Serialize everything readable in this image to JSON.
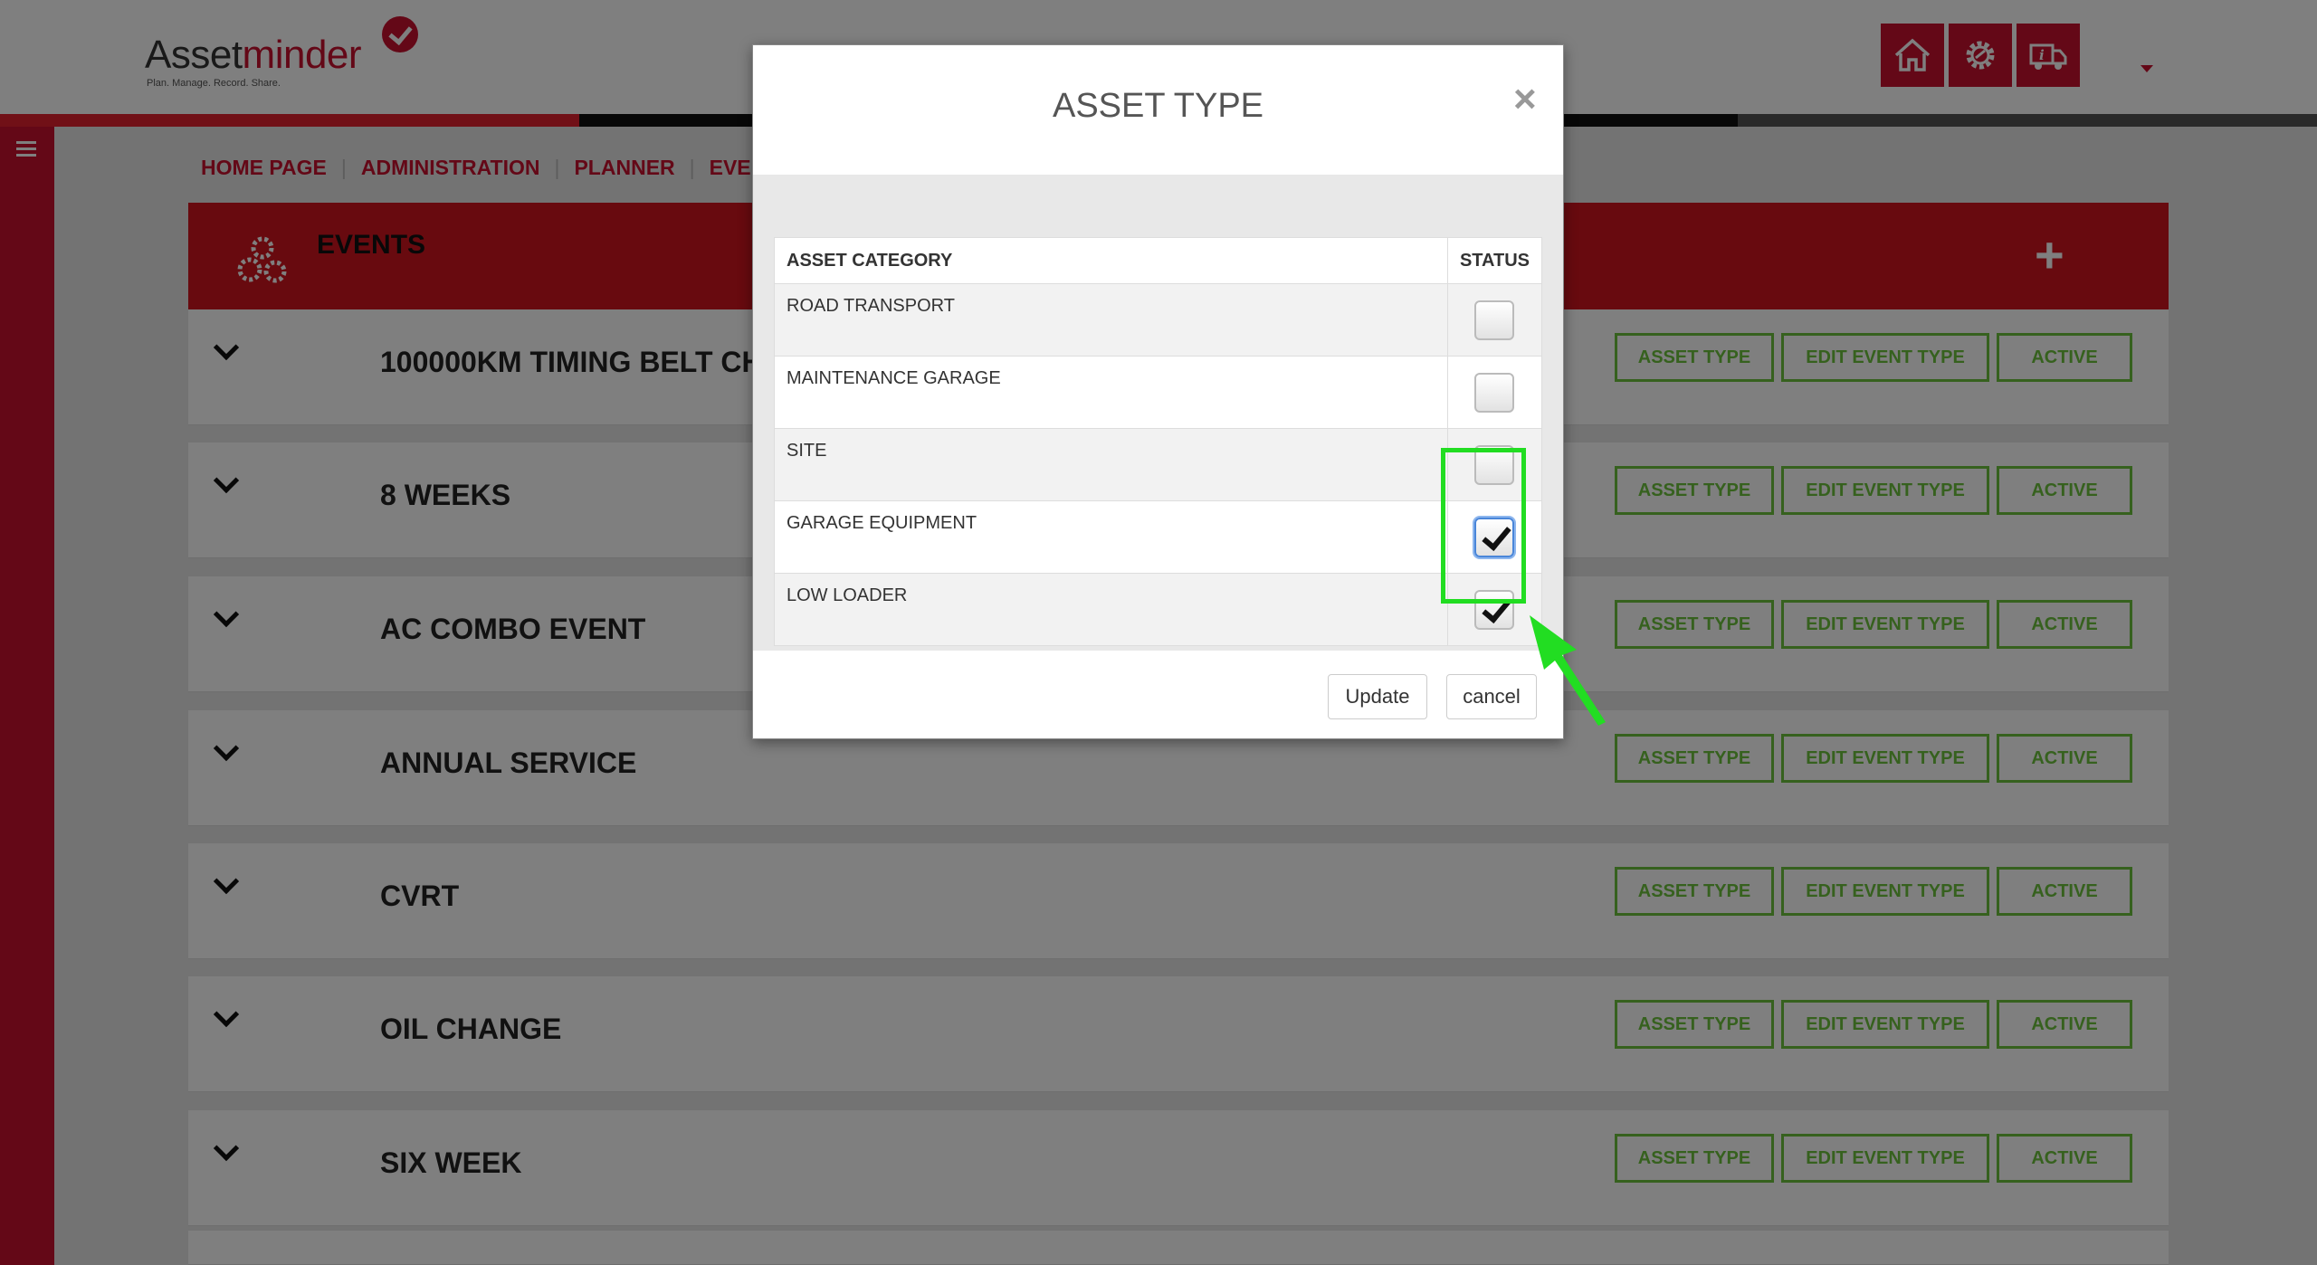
{
  "app": {
    "logo_main": "Asset",
    "logo_accent": "minder",
    "logo_tagline": "Plan. Manage. Record. Share."
  },
  "top_icons": [
    "home-icon",
    "settings-icon",
    "truck-info-icon"
  ],
  "progress": {
    "red_fraction": 0.25
  },
  "breadcrumb": [
    "HOME PAGE",
    "ADMINISTRATION",
    "PLANNER",
    "EVENTS"
  ],
  "events": {
    "title": "EVENTS",
    "add_label": "+",
    "rows": [
      {
        "name": "100000KM TIMING BELT CHANGE"
      },
      {
        "name": "8 WEEKS"
      },
      {
        "name": "AC COMBO EVENT"
      },
      {
        "name": "ANNUAL SERVICE"
      },
      {
        "name": "CVRT"
      },
      {
        "name": "OIL CHANGE"
      },
      {
        "name": "SIX WEEK"
      }
    ],
    "row_buttons": {
      "asset_type": "ASSET TYPE",
      "edit_event_type": "EDIT EVENT TYPE",
      "active": "ACTIVE"
    }
  },
  "modal": {
    "title": "ASSET TYPE",
    "close": "×",
    "columns": [
      "ASSET CATEGORY",
      "STATUS"
    ],
    "rows": [
      {
        "category": "ROAD TRANSPORT",
        "checked": false
      },
      {
        "category": "MAINTENANCE GARAGE",
        "checked": false
      },
      {
        "category": "SITE",
        "checked": false
      },
      {
        "category": "GARAGE EQUIPMENT",
        "checked": true
      },
      {
        "category": "LOW LOADER",
        "checked": true
      }
    ],
    "update_label": "Update",
    "cancel_label": "cancel"
  },
  "colors": {
    "brand_red": "#c8102e",
    "button_green": "#6cc23d",
    "highlight_green": "#22dd22"
  }
}
